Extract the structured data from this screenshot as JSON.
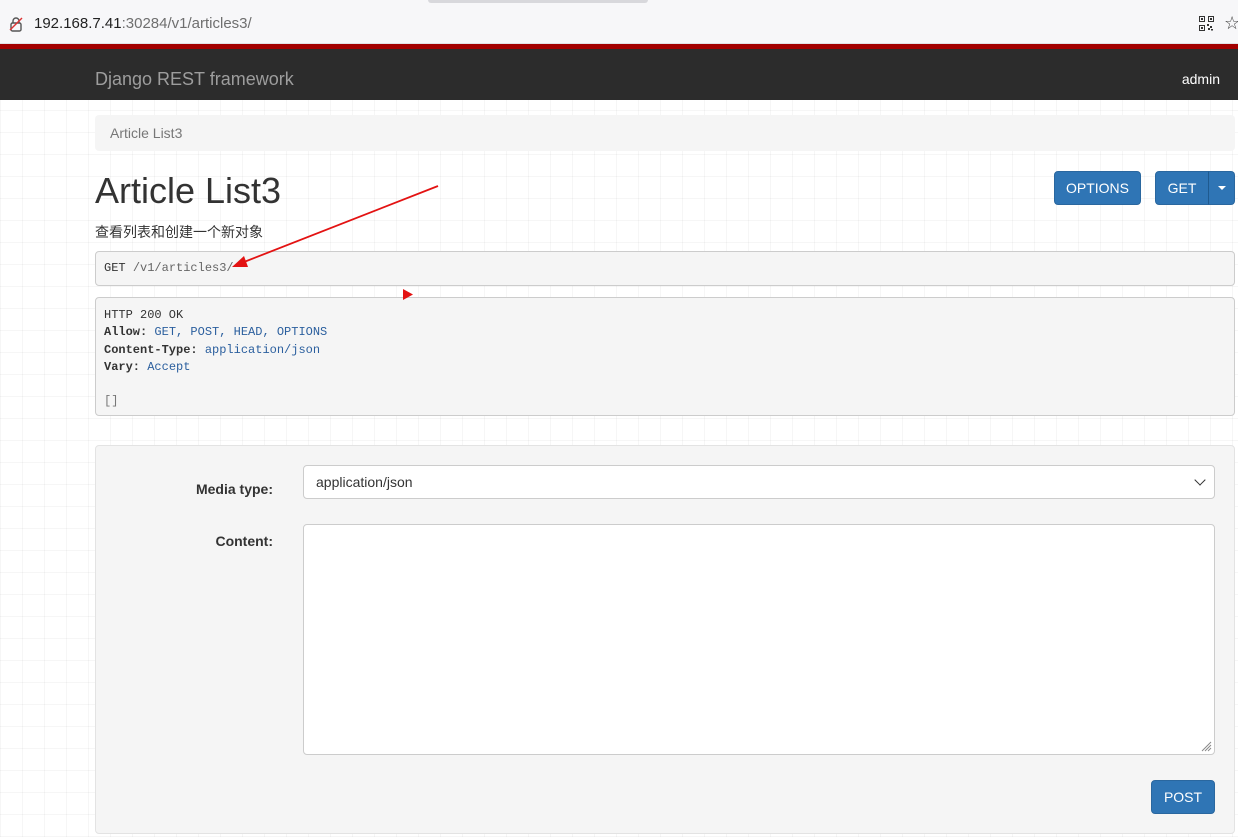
{
  "browser": {
    "url_host": "192.168.7.41",
    "url_rest": ":30284/v1/articles3/"
  },
  "navbar": {
    "brand": "Django REST framework",
    "user": "admin"
  },
  "breadcrumb": {
    "current": "Article List3"
  },
  "page": {
    "title": "Article List3",
    "description": "查看列表和创建一个新对象"
  },
  "buttons": {
    "options": "OPTIONS",
    "get": "GET",
    "post": "POST"
  },
  "request": {
    "method": "GET",
    "path": "/v1/articles3/"
  },
  "response": {
    "status": "HTTP 200 OK",
    "headers": [
      {
        "key": "Allow:",
        "value": "GET, POST, HEAD, OPTIONS"
      },
      {
        "key": "Content-Type:",
        "value": "application/json"
      },
      {
        "key": "Vary:",
        "value": "Accept"
      }
    ],
    "body": "[]"
  },
  "form": {
    "media_type_label": "Media type:",
    "media_type_value": "application/json",
    "content_label": "Content:",
    "content_value": ""
  },
  "colors": {
    "navbar_bg": "#2c2c2c",
    "navbar_accent": "#a30000",
    "button_primary": "#2f75b5",
    "annotation_arrow": "#e31212"
  }
}
